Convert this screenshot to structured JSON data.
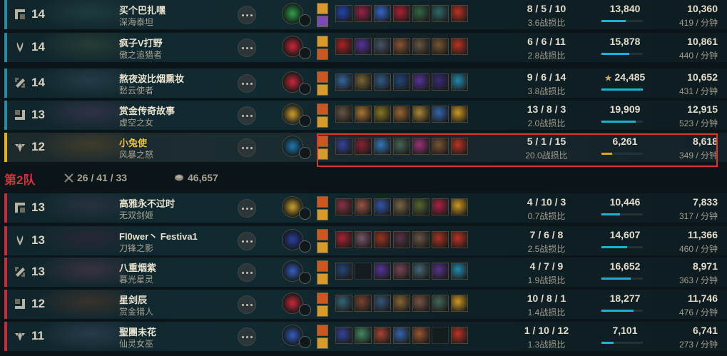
{
  "colors": {
    "blue_team": "#2a8aa0",
    "red_team": "#c0303c",
    "self": "#e2b41c",
    "highlight": "#d4392c",
    "gold_bar": "#1bb3d4"
  },
  "team2": {
    "label": "第2队",
    "kills": "26 / 41 / 33",
    "gold": "46,657",
    "swords_icon": "crossed-swords-icon",
    "gold_icon": "gold-coins-icon"
  },
  "players": [
    {
      "team": "blue",
      "role_icon": "top-lane-icon",
      "level": "14",
      "name": "买个巴扎嘿",
      "champion": "深海泰坦",
      "art": "#2a4a4e",
      "rune": "#2f8f44",
      "items": [
        "#2244aa",
        "#992244",
        "#3366cc",
        "#aa2233",
        "#336644",
        "#2d6a66",
        "#bb3322"
      ],
      "kda": "8 / 5 / 10",
      "kda_ratio": "3.6战损比",
      "gold": "13,840",
      "gold_frac": 0.58,
      "damage": "10,360",
      "dpm": "419 / 分钟",
      "spell1": "#d89a2a",
      "spell2": "#7a4bb8"
    },
    {
      "team": "blue",
      "role_icon": "jungle-icon",
      "level": "14",
      "name": "疯子V打野",
      "champion": "傲之追猎者",
      "art": "#3a4c3a",
      "rune": "#b82535",
      "items": [
        "#aa2222",
        "#553399",
        "#445566",
        "#885533",
        "#665544",
        "#775533",
        "#bb3322"
      ],
      "kda": "6 / 6 / 11",
      "kda_ratio": "2.8战损比",
      "gold": "15,878",
      "gold_frac": 0.68,
      "damage": "10,861",
      "dpm": "440 / 分钟",
      "spell1": "#d89a2a",
      "spell2": "#cc5522"
    },
    {
      "team": "blue",
      "role_icon": "mid-lane-icon",
      "level": "14",
      "name": "熬夜波比烟熏妆",
      "champion": "愁云使者",
      "art": "#354a5a",
      "rune": "#b82535",
      "items": [
        "#336699",
        "#776633",
        "#2d5a88",
        "#224477",
        "#553399",
        "#3a2a77",
        "#2288aa"
      ],
      "kda": "9 / 6 / 14",
      "kda_ratio": "3.8战损比",
      "gold": "24,485",
      "gold_frac": 1.0,
      "damage": "10,652",
      "dpm": "431 / 分钟",
      "spell1": "#cc5522",
      "spell2": "#d89a2a",
      "star": "★"
    },
    {
      "team": "blue",
      "role_icon": "bot-lane-icon",
      "level": "13",
      "name": "赏金传奇故事",
      "champion": "虚空之女",
      "art": "#4a3a5a",
      "rune": "#b8902a",
      "items": [
        "#665544",
        "#aa7733",
        "#887722",
        "#996633",
        "#aa8833",
        "#3366aa",
        "#cc9922"
      ],
      "kda": "13 / 8 / 3",
      "kda_ratio": "2.0战损比",
      "gold": "19,909",
      "gold_frac": 0.82,
      "damage": "12,915",
      "dpm": "523 / 分钟",
      "spell1": "#cc5522",
      "spell2": "#d89a2a"
    },
    {
      "team": "blue",
      "role_icon": "support-icon",
      "level": "12",
      "name": "小兔使",
      "champion": "风暴之怒",
      "art": "#5a4a2a",
      "rune": "#1c6e9e",
      "items": [
        "#334499",
        "#882233",
        "#3377bb",
        "#446655",
        "#993377",
        "#775533",
        "#bb3322"
      ],
      "kda": "5 / 1 / 15",
      "kda_ratio": "20.0战损比",
      "gold": "6,261",
      "gold_frac": 0.25,
      "damage": "8,618",
      "dpm": "349 / 分钟",
      "spell1": "#cc5522",
      "spell2": "#d89a2a",
      "me": true
    },
    {
      "team": "red",
      "role_icon": "top-lane-icon",
      "level": "13",
      "name": "高雅永不过时",
      "champion": "无双剑姬",
      "art": "#3a3a4e",
      "rune": "#b8902a",
      "items": [
        "#883344",
        "#995544",
        "#3355aa",
        "#776644",
        "#556633",
        "#aa2244",
        "#cc9922"
      ],
      "kda": "4 / 10 / 3",
      "kda_ratio": "0.7战损比",
      "gold": "10,446",
      "gold_frac": 0.45,
      "damage": "7,833",
      "dpm": "317 / 分钟",
      "spell1": "#cc5522",
      "spell2": "#d89a2a"
    },
    {
      "team": "red",
      "role_icon": "jungle-icon",
      "level": "13",
      "name": "Fl0wer丶 Festiva1",
      "champion": "刀锋之影",
      "art": "#3a2a3a",
      "rune": "#2a3a8e",
      "items": [
        "#aa2233",
        "#775566",
        "#993322",
        "#553344",
        "#665544",
        "#aa3322",
        "#bb3322"
      ],
      "kda": "7 / 6 / 8",
      "kda_ratio": "2.5战损比",
      "gold": "14,607",
      "gold_frac": 0.62,
      "damage": "11,366",
      "dpm": "460 / 分钟",
      "spell1": "#cc5522",
      "spell2": "#d89a2a"
    },
    {
      "team": "red",
      "role_icon": "mid-lane-icon",
      "level": "13",
      "name": "八重烟紫",
      "champion": "暮光星灵",
      "art": "#5a3a4e",
      "rune": "#3355aa",
      "items": [
        "#224477",
        "",
        "#553399",
        "#774455",
        "#446677",
        "#553388",
        "#2288aa"
      ],
      "kda": "4 / 7 / 9",
      "kda_ratio": "1.9战损比",
      "gold": "16,652",
      "gold_frac": 0.7,
      "damage": "8,971",
      "dpm": "363 / 分钟",
      "spell1": "#cc5522",
      "spell2": "#d89a2a"
    },
    {
      "team": "red",
      "role_icon": "bot-lane-icon",
      "level": "12",
      "name": "星剑辰",
      "champion": "赏金猎人",
      "art": "#5a3a2a",
      "rune": "#b82535",
      "items": [
        "#336677",
        "#774433",
        "#335577",
        "#886633",
        "#775544",
        "#446655",
        "#cc9922"
      ],
      "kda": "10 / 8 / 1",
      "kda_ratio": "1.4战损比",
      "gold": "18,277",
      "gold_frac": 0.78,
      "damage": "11,746",
      "dpm": "476 / 分钟",
      "spell1": "#cc5522",
      "spell2": "#d89a2a"
    },
    {
      "team": "red",
      "role_icon": "support-icon",
      "level": "11",
      "name": "聖團未花",
      "champion": "仙灵女巫",
      "art": "#3a4a5e",
      "rune": "#3355aa",
      "items": [
        "#334499",
        "#448866",
        "#aa4433",
        "#3366aa",
        "#995533",
        "",
        "#bb3322"
      ],
      "kda": "1 / 10 / 12",
      "kda_ratio": "1.3战损比",
      "gold": "7,101",
      "gold_frac": 0.3,
      "damage": "6,741",
      "dpm": "273 / 分钟",
      "spell1": "#cc5522",
      "spell2": "#d89a2a"
    }
  ]
}
